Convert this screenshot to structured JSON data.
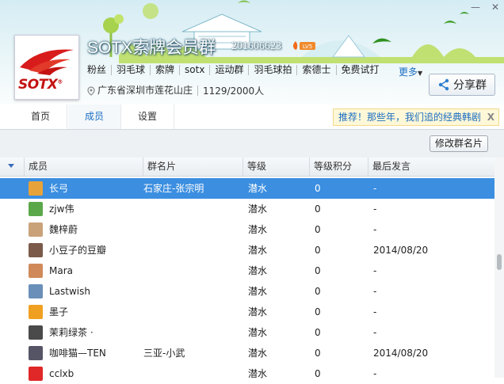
{
  "window": {
    "minimize": "—",
    "close": "✕"
  },
  "group": {
    "logo_text": "SOTX",
    "logo_mark": "®",
    "title": "SOTX索牌会员群",
    "id": "201606623",
    "level": "LV5",
    "tags": [
      "粉丝",
      "羽毛球",
      "索牌",
      "sotx",
      "运动群",
      "羽毛球拍",
      "索德士",
      "免费试打"
    ],
    "more": "更多",
    "location": "广东省深圳市莲花山庄",
    "members": "1129/2000人",
    "share_button": "分享群"
  },
  "tabs": [
    "首页",
    "成员",
    "设置"
  ],
  "active_tab": "成员",
  "promo": {
    "text": "推荐！那些年，我们追的经典韩剧",
    "close": "X"
  },
  "toolbar": {
    "edit_card": "修改群名片"
  },
  "table": {
    "columns": [
      "成员",
      "群名片",
      "等级",
      "等级积分",
      "最后发言"
    ],
    "rows": [
      {
        "name": "长弓",
        "card": "石家庄-张宗明",
        "level": "潜水",
        "points": "0",
        "last": "-",
        "selected": true,
        "avatar": "#e8a23a"
      },
      {
        "name": "zjw伟",
        "card": "",
        "level": "潜水",
        "points": "0",
        "last": "-",
        "selected": false,
        "avatar": "#5aa84a"
      },
      {
        "name": "魏梓蔚",
        "card": "",
        "level": "潜水",
        "points": "0",
        "last": "-",
        "selected": false,
        "avatar": "#c9a27a"
      },
      {
        "name": "小豆子的豆瓣",
        "card": "",
        "level": "潜水",
        "points": "0",
        "last": "2014/08/20",
        "selected": false,
        "avatar": "#7b5a4a"
      },
      {
        "name": "Mara",
        "card": "",
        "level": "潜水",
        "points": "0",
        "last": "-",
        "selected": false,
        "avatar": "#d08a5a"
      },
      {
        "name": "Lastwish",
        "card": "",
        "level": "潜水",
        "points": "0",
        "last": "-",
        "selected": false,
        "avatar": "#6a8fb8"
      },
      {
        "name": "墨子",
        "card": "",
        "level": "潜水",
        "points": "0",
        "last": "-",
        "selected": false,
        "avatar": "#f0a020"
      },
      {
        "name": "茉莉绿茶 ·",
        "card": "",
        "level": "潜水",
        "points": "0",
        "last": "-",
        "selected": false,
        "avatar": "#4a4a4a"
      },
      {
        "name": "咖啡猫—TEN",
        "card": "三亚-小武",
        "level": "潜水",
        "points": "0",
        "last": "2014/08/20",
        "selected": false,
        "avatar": "#555566"
      },
      {
        "name": "cclxb",
        "card": "",
        "level": "潜水",
        "points": "0",
        "last": "-",
        "selected": false,
        "avatar": "#e02828"
      }
    ]
  },
  "colors": {
    "accent": "#3b8ee0",
    "link": "#1a6dc2",
    "brand_red": "#c41212"
  }
}
